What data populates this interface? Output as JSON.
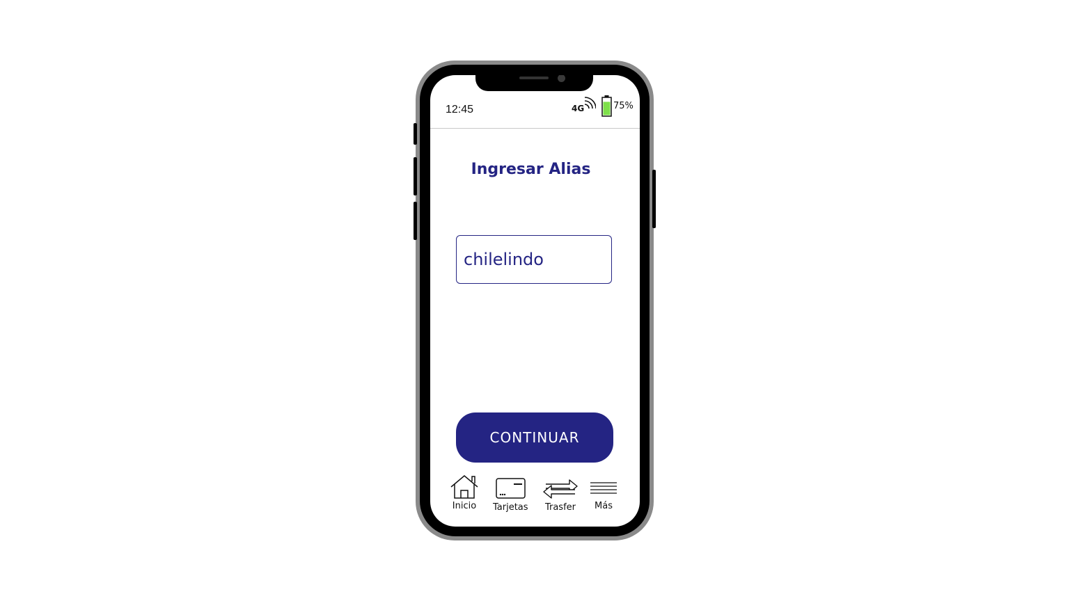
{
  "status_bar": {
    "time": "12:45",
    "network": "4G",
    "battery_percent": "75%",
    "battery_level": 0.75,
    "battery_color": "#7ee04a"
  },
  "screen": {
    "title": "Ingresar Alias",
    "alias_value": "chilelindo",
    "continue_label": "CONTINUAR"
  },
  "colors": {
    "primary": "#242483"
  },
  "bottom_nav": {
    "items": [
      {
        "label": "Inicio",
        "icon": "home-icon"
      },
      {
        "label": "Tarjetas",
        "icon": "card-icon"
      },
      {
        "label": "Trasfer",
        "icon": "transfer-arrows-icon"
      },
      {
        "label": "Más",
        "icon": "menu-lines-icon"
      }
    ]
  }
}
